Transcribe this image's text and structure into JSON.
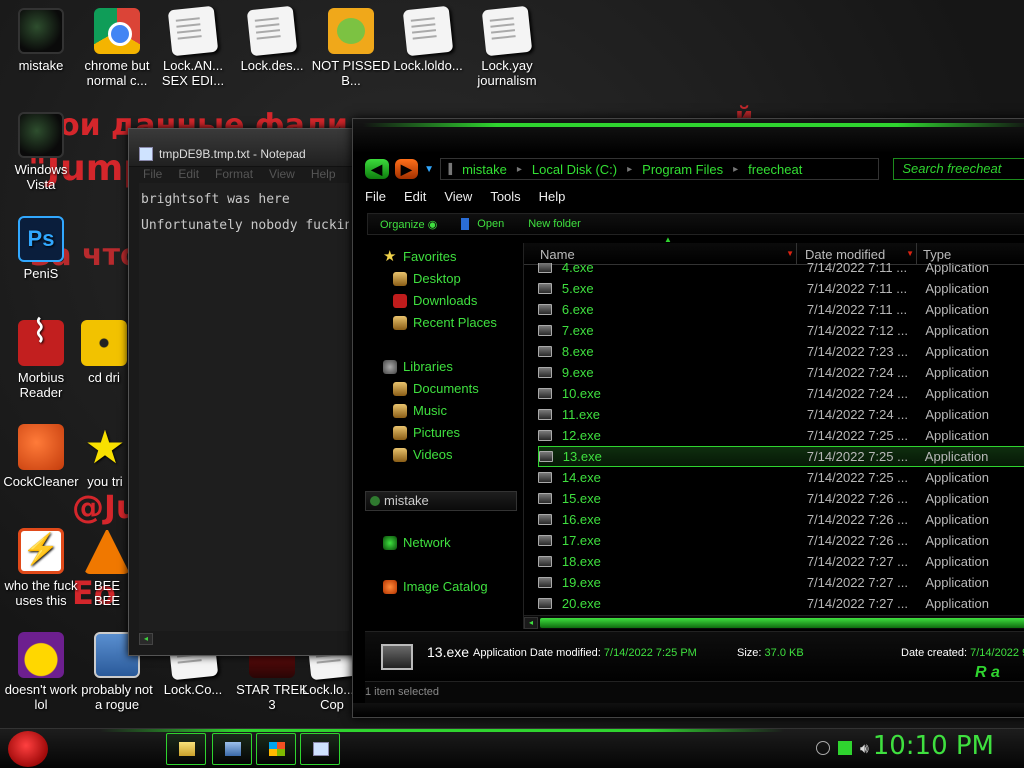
{
  "wallpaper": {
    "lines": [
      "вои данные фали",
      "\"Jump",
      "За что?",
      "@Ju",
      "Ео",
      "й"
    ]
  },
  "desktop_icons": [
    {
      "label": "mistake",
      "icon": "orb-green-icon"
    },
    {
      "label": "chrome but normal c...",
      "icon": "chrome-icon"
    },
    {
      "label": "Lock.AN... SEX EDI...",
      "icon": "document-icon"
    },
    {
      "label": "Lock.des...",
      "icon": "document-icon"
    },
    {
      "label": "NOT PISSED B...",
      "icon": "bad-piggies-icon"
    },
    {
      "label": "Lock.loldo...",
      "icon": "document-icon"
    },
    {
      "label": "Lock.yay journalism",
      "icon": "document-icon"
    },
    {
      "label": "Windows Vista",
      "icon": "recycle-bin-icon"
    },
    {
      "label": "PeniS",
      "icon": "photoshop-icon"
    },
    {
      "label": "Morbius Reader",
      "icon": "pdf-reader-icon"
    },
    {
      "label": "cd dri",
      "icon": "cd-icon"
    },
    {
      "label": "CockCleaner",
      "icon": "ccleaner-icon"
    },
    {
      "label": "you tri",
      "icon": "star-icon"
    },
    {
      "label": "who the fuck uses this",
      "icon": "lightning-icon"
    },
    {
      "label": "BEE BEE",
      "icon": "vlc-icon"
    },
    {
      "label": "doesn't work lol",
      "icon": "yahoo-icon"
    },
    {
      "label": "probably not a rogue",
      "icon": "rogue-icon"
    },
    {
      "label": "Lock.Co...",
      "icon": "document-icon"
    },
    {
      "label": "STAR TREK 3",
      "icon": "star-trek-icon"
    },
    {
      "label": "Lock.lo... - Cop",
      "icon": "document-icon"
    }
  ],
  "notepad": {
    "title": "tmpDE9B.tmp.txt - Notepad",
    "menu": [
      "File",
      "Edit",
      "Format",
      "View",
      "Help"
    ],
    "lines": [
      "brightsoft was here",
      "Unfortunately nobody fuckin"
    ]
  },
  "explorer": {
    "breadcrumb": [
      "mistake",
      "Local Disk (C:)",
      "Program Files",
      "freecheat"
    ],
    "search_placeholder": "Search freecheat",
    "menu": [
      "File",
      "Edit",
      "View",
      "Tools",
      "Help"
    ],
    "commands": {
      "organize": "Organize",
      "open": "Open",
      "new_folder": "New folder"
    },
    "nav": {
      "favorites": "Favorites",
      "desktop": "Desktop",
      "downloads": "Downloads",
      "recent": "Recent Places",
      "libraries": "Libraries",
      "documents": "Documents",
      "music": "Music",
      "pictures": "Pictures",
      "videos": "Videos",
      "user": "mistake",
      "network": "Network",
      "image_catalog": "Image Catalog"
    },
    "columns": {
      "name": "Name",
      "date": "Date modified",
      "type": "Type"
    },
    "files": [
      {
        "name": "4.exe",
        "date": "7/14/2022 7:11 ...",
        "type": "Application"
      },
      {
        "name": "5.exe",
        "date": "7/14/2022 7:11 ...",
        "type": "Application"
      },
      {
        "name": "6.exe",
        "date": "7/14/2022 7:11 ...",
        "type": "Application"
      },
      {
        "name": "7.exe",
        "date": "7/14/2022 7:12 ...",
        "type": "Application"
      },
      {
        "name": "8.exe",
        "date": "7/14/2022 7:23 ...",
        "type": "Application"
      },
      {
        "name": "9.exe",
        "date": "7/14/2022 7:24 ...",
        "type": "Application"
      },
      {
        "name": "10.exe",
        "date": "7/14/2022 7:24 ...",
        "type": "Application"
      },
      {
        "name": "11.exe",
        "date": "7/14/2022 7:24 ...",
        "type": "Application"
      },
      {
        "name": "12.exe",
        "date": "7/14/2022 7:25 ...",
        "type": "Application"
      },
      {
        "name": "13.exe",
        "date": "7/14/2022 7:25 ...",
        "type": "Application",
        "selected": true
      },
      {
        "name": "14.exe",
        "date": "7/14/2022 7:25 ...",
        "type": "Application"
      },
      {
        "name": "15.exe",
        "date": "7/14/2022 7:26 ...",
        "type": "Application"
      },
      {
        "name": "16.exe",
        "date": "7/14/2022 7:26 ...",
        "type": "Application"
      },
      {
        "name": "17.exe",
        "date": "7/14/2022 7:26 ...",
        "type": "Application"
      },
      {
        "name": "18.exe",
        "date": "7/14/2022 7:27 ...",
        "type": "Application"
      },
      {
        "name": "19.exe",
        "date": "7/14/2022 7:27 ...",
        "type": "Application"
      },
      {
        "name": "20.exe",
        "date": "7/14/2022 7:27 ...",
        "type": "Application"
      }
    ],
    "details": {
      "name": "13.exe",
      "type": "Application",
      "date_modified_label": "Date modified:",
      "date_modified": "7/14/2022 7:25 PM",
      "size_label": "Size:",
      "size": "37.0 KB",
      "date_created_label": "Date created:",
      "date_created": "7/14/2022 9",
      "logo": "R a"
    },
    "status": "1 item selected"
  },
  "taskbar": {
    "clock": "10:10 PM"
  },
  "colors": {
    "accent": "#2fd42f",
    "wall_text": "#d4262b",
    "background": "#1c1c1c"
  }
}
